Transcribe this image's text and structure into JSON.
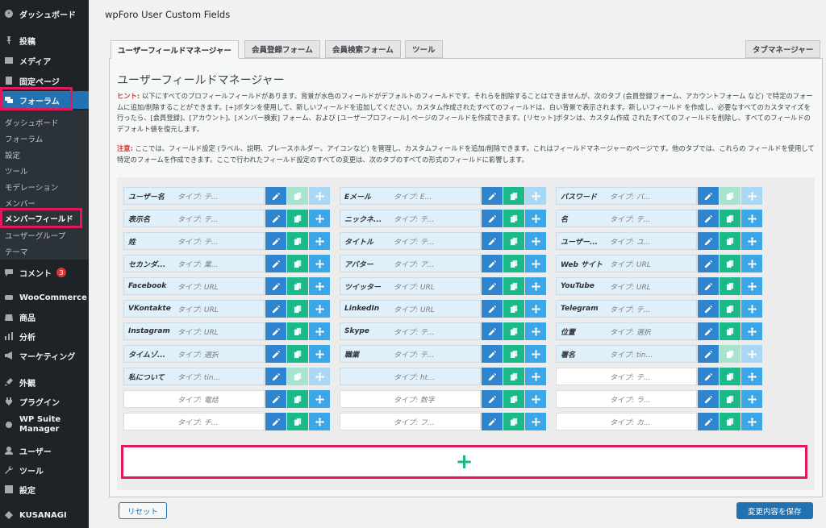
{
  "sidebar": {
    "items": [
      {
        "label": "ダッシュボード",
        "icon": "dashboard-icon"
      },
      {
        "label": "投稿",
        "icon": "pin-icon"
      },
      {
        "label": "メディア",
        "icon": "media-icon"
      },
      {
        "label": "固定ページ",
        "icon": "page-icon"
      },
      {
        "label": "フォーラム",
        "icon": "forum-icon"
      },
      {
        "label": "コメント",
        "icon": "comment-icon",
        "badge": "3"
      },
      {
        "label": "WooCommerce",
        "icon": "woocommerce-icon"
      },
      {
        "label": "商品",
        "icon": "product-icon"
      },
      {
        "label": "分析",
        "icon": "analytics-icon"
      },
      {
        "label": "マーケティング",
        "icon": "megaphone-icon"
      },
      {
        "label": "外観",
        "icon": "brush-icon"
      },
      {
        "label": "プラグイン",
        "icon": "plugin-icon"
      },
      {
        "label": "WP Suite Manager",
        "icon": "gear-icon"
      },
      {
        "label": "ユーザー",
        "icon": "user-icon"
      },
      {
        "label": "ツール",
        "icon": "wrench-icon"
      },
      {
        "label": "設定",
        "icon": "settings-icon"
      },
      {
        "label": "KUSANAGI",
        "icon": "kusanagi-icon"
      }
    ],
    "submenu": [
      "ダッシュボード",
      "フォーラム",
      "設定",
      "ツール",
      "モデレーション",
      "メンバー",
      "メンバーフィールド",
      "ユーザーグループ",
      "テーマ"
    ]
  },
  "page_title": "wpForo User Custom Fields",
  "tabs": [
    "ユーザーフィールドマネージャー",
    "会員登録フォーム",
    "会員検索フォーム",
    "ツール"
  ],
  "tab_right": "タブマネージャー",
  "section_title": "ユーザーフィールドマネージャー",
  "hint": {
    "label": "ヒント:",
    "text": " 以下にすべてのプロフィールフィールドがあります。背景が水色のフィールドがデフォルトのフィールドです。それらを削除することはできませんが、次のタブ (会員登録フォーム、アカウントフォーム など) で特定のフォームに追加/削除することができます。[+]ボタンを使用して、新しいフィールドを追加してください。カスタム作成されたすべてのフィールドは、白い背景で表示されます。新しいフィールド を作成し、必要なすべてのカスタマイズを行ったら、[会員登録]、[アカウント]、[メンバー検索] フォーム、および [ユーザープロフィール] ページのフィールドを作成できます。[リセット]ボタンは、カスタム作成 されたすべてのフィールドを削除し、すべてのフィールドのデフォルト値を復元します。"
  },
  "note": {
    "label": "注意:",
    "text": " ここでは、フィールド設定 (ラベル、説明、プレースホルダー、アイコンなど) を管理し、カスタムフィールドを追加/削除できます。これはフィールドマネージャーのページです。他のタブでは、これらの フィールドを使用して特定のフォームを作成できます。ここで行われたフィールド設定のすべての変更は、次のタブのすべての形式のフィールドに影響します。"
  },
  "columns": [
    [
      {
        "label": "ユーザー名",
        "type": "タイプ: テ...",
        "custom": false,
        "copy_off": true,
        "move_off": true
      },
      {
        "label": "表示名",
        "type": "タイプ: テ...",
        "custom": false,
        "copy_off": false,
        "move_off": false
      },
      {
        "label": "姓",
        "type": "タイプ: テ...",
        "custom": false,
        "copy_off": false,
        "move_off": false
      },
      {
        "label": "セカンダ...",
        "type": "タイプ: 業...",
        "custom": false,
        "copy_off": false,
        "move_off": false
      },
      {
        "label": "Facebook",
        "type": "タイプ: URL",
        "custom": false,
        "copy_off": false,
        "move_off": false
      },
      {
        "label": "VKontakte",
        "type": "タイプ: URL",
        "custom": false,
        "copy_off": false,
        "move_off": false
      },
      {
        "label": "Instagram",
        "type": "タイプ: URL",
        "custom": false,
        "copy_off": false,
        "move_off": false
      },
      {
        "label": "タイムゾ...",
        "type": "タイプ: 選択",
        "custom": false,
        "copy_off": false,
        "move_off": false
      },
      {
        "label": "私について",
        "type": "タイプ: tin...",
        "custom": false,
        "copy_off": true,
        "move_off": true
      },
      {
        "label": "",
        "type": "タイプ: 電話",
        "custom": true,
        "copy_off": false,
        "move_off": false
      },
      {
        "label": "",
        "type": "タイプ: チ...",
        "custom": true,
        "copy_off": false,
        "move_off": false
      }
    ],
    [
      {
        "label": "Eメール",
        "type": "タイプ: E...",
        "custom": false,
        "copy_off": false,
        "move_off": true
      },
      {
        "label": "ニックネ...",
        "type": "タイプ: テ...",
        "custom": false,
        "copy_off": false,
        "move_off": false
      },
      {
        "label": "タイトル",
        "type": "タイプ: テ...",
        "custom": false,
        "copy_off": false,
        "move_off": false
      },
      {
        "label": "アバター",
        "type": "タイプ: ア...",
        "custom": false,
        "copy_off": false,
        "move_off": false
      },
      {
        "label": "ツイッター",
        "type": "タイプ: URL",
        "custom": false,
        "copy_off": false,
        "move_off": false
      },
      {
        "label": "LinkedIn",
        "type": "タイプ: URL",
        "custom": false,
        "copy_off": false,
        "move_off": false
      },
      {
        "label": "Skype",
        "type": "タイプ: テ...",
        "custom": false,
        "copy_off": false,
        "move_off": false
      },
      {
        "label": "職業",
        "type": "タイプ: テ...",
        "custom": false,
        "copy_off": false,
        "move_off": false
      },
      {
        "label": "",
        "type": "タイプ: ht...",
        "custom": false,
        "copy_off": false,
        "move_off": false
      },
      {
        "label": "",
        "type": "タイプ: 数字",
        "custom": true,
        "copy_off": false,
        "move_off": false
      },
      {
        "label": "",
        "type": "タイプ: フ...",
        "custom": true,
        "copy_off": false,
        "move_off": false
      }
    ],
    [
      {
        "label": "パスワード",
        "type": "タイプ: パ...",
        "custom": false,
        "copy_off": true,
        "move_off": true
      },
      {
        "label": "名",
        "type": "タイプ: テ...",
        "custom": false,
        "copy_off": false,
        "move_off": false
      },
      {
        "label": "ユーザー...",
        "type": "タイプ: ユ...",
        "custom": false,
        "copy_off": false,
        "move_off": false
      },
      {
        "label": "Web サイト",
        "type": "タイプ: URL",
        "custom": false,
        "copy_off": false,
        "move_off": false
      },
      {
        "label": "YouTube",
        "type": "タイプ: URL",
        "custom": false,
        "copy_off": false,
        "move_off": false
      },
      {
        "label": "Telegram",
        "type": "タイプ: テ...",
        "custom": false,
        "copy_off": false,
        "move_off": false
      },
      {
        "label": "位置",
        "type": "タイプ: 選択",
        "custom": false,
        "copy_off": false,
        "move_off": false
      },
      {
        "label": "署名",
        "type": "タイプ: tin...",
        "custom": false,
        "copy_off": true,
        "move_off": true
      },
      {
        "label": "",
        "type": "タイプ: テ...",
        "custom": true,
        "copy_off": false,
        "move_off": false
      },
      {
        "label": "",
        "type": "タイプ: ラ...",
        "custom": true,
        "copy_off": false,
        "move_off": false
      },
      {
        "label": "",
        "type": "タイプ: カ...",
        "custom": true,
        "copy_off": false,
        "move_off": false
      }
    ]
  ],
  "add_button": "+",
  "reset_button": "リセット",
  "save_button": "変更内容を保存"
}
